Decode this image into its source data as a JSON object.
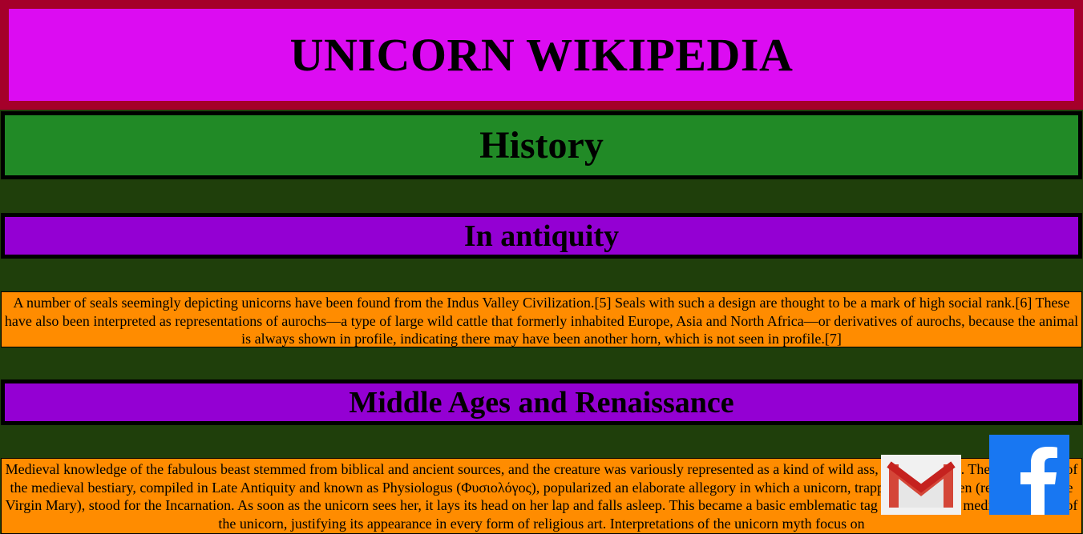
{
  "page_title": "UNICORN WIKIPEDIA",
  "history_heading": "History",
  "sections": [
    {
      "heading": "In antiquity",
      "text": "A number of seals seemingly depicting unicorns have been found from the Indus Valley Civilization.[5] Seals with such a design are thought to be a mark of high social rank.[6] These have also been interpreted as representations of aurochs—a type of large wild cattle that formerly inhabited Europe, Asia and North Africa—or derivatives of aurochs, because the animal is always shown in profile, indicating there may have been another horn, which is not seen in profile.[7]"
    },
    {
      "heading": "Middle Ages and Renaissance",
      "text": "Medieval knowledge of the fabulous beast stemmed from biblical and ancient sources, and the creature was variously represented as a kind of wild ass, goat, or horse. The predecessor of the medieval bestiary, compiled in Late Antiquity and known as Physiologus (Φυσιολόγος), popularized an elaborate allegory in which a unicorn, trapped by a maiden (representing the Virgin Mary), stood for the Incarnation. As soon as the unicorn sees her, it lays its head on her lap and falls asleep. This became a basic emblematic tag that underlies medieval notions of the unicorn, justifying its appearance in every form of religious art. Interpretations of the unicorn myth focus on"
    }
  ],
  "social_icons": [
    "gmail-icon",
    "facebook-icon"
  ],
  "colors": {
    "background": "#1f3f0b",
    "title_bg": "#dc0cf2",
    "title_border": "#a5002a",
    "history_bg": "#218a26",
    "section_bg": "#9400d3",
    "para_bg": "#ff8c00",
    "facebook": "#1877f2"
  }
}
